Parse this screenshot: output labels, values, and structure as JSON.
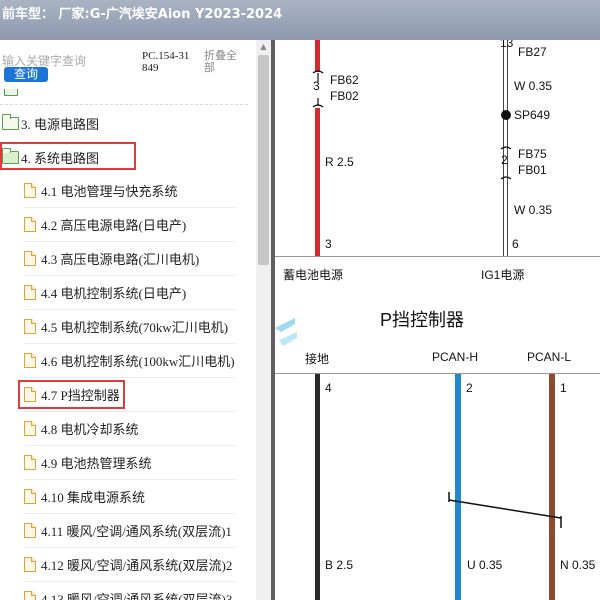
{
  "titlebar": {
    "text": "前车型： 厂家:G-广汽埃安Aion Y2023-2024"
  },
  "search": {
    "placeholder": "输入关键字查询",
    "button_label": "查询",
    "code": "PC.154-31849",
    "collapse_label": "折叠全部"
  },
  "tree": {
    "folders": [
      {
        "label": "3. 电源电路图",
        "state": "closed"
      },
      {
        "label": "4. 系统电路图",
        "state": "open",
        "highlighted": true
      }
    ],
    "children": [
      {
        "label": "4.1 电池管理与快充系统"
      },
      {
        "label": "4.2 高压电源电路(日电产)"
      },
      {
        "label": "4.3 高压电源电路(汇川电机)"
      },
      {
        "label": "4.4 电机控制系统(日电产)"
      },
      {
        "label": "4.5 电机控制系统(70kw汇川电机)"
      },
      {
        "label": "4.6 电机控制系统(100kw汇川电机)"
      },
      {
        "label": "4.7 P挡控制器",
        "highlighted": true
      },
      {
        "label": "4.8 电机冷却系统"
      },
      {
        "label": "4.9 电池热管理系统"
      },
      {
        "label": "4.10 集成电源系统"
      },
      {
        "label": "4.11 暖风/空调/通风系统(双层流)1"
      },
      {
        "label": "4.12 暖风/空调/通风系统(双层流)2"
      },
      {
        "label": "4.13 暖风/空调/通风系统(双层流)3"
      }
    ]
  },
  "diagram": {
    "left_wire": {
      "fuse_pin": "3",
      "fuse_top": "FB62",
      "fuse_bottom": "FB02",
      "spec": "R 2.5",
      "pin": "3",
      "color": "#d42a2a"
    },
    "right_wire": {
      "top_pin": "13",
      "top_label": "FB27",
      "spec_top": "W 0.35",
      "splice": "SP649",
      "fuse_pin": "2",
      "fuse_top": "FB75",
      "fuse_bottom": "FB01",
      "spec_bottom": "W 0.35",
      "pin": "6",
      "color": "#ffffff"
    },
    "source_labels": {
      "battery": "蓄电池电源",
      "ig1": "IG1电源"
    },
    "module_title": "P挡控制器",
    "connector_labels": {
      "ground": "接地",
      "pcan_h": "PCAN-H",
      "pcan_l": "PCAN-L"
    },
    "bottom_pins": {
      "ground": "4",
      "pcan_h": "2",
      "pcan_l": "1"
    },
    "bottom_specs": {
      "ground": "B 2.5",
      "pcan_h": "U 0.35",
      "pcan_l": "N 0.35"
    },
    "wire_colors": {
      "ground": "#2a2a2a",
      "pcan_h": "#1e88d0",
      "pcan_l": "#8e4a2e"
    }
  }
}
